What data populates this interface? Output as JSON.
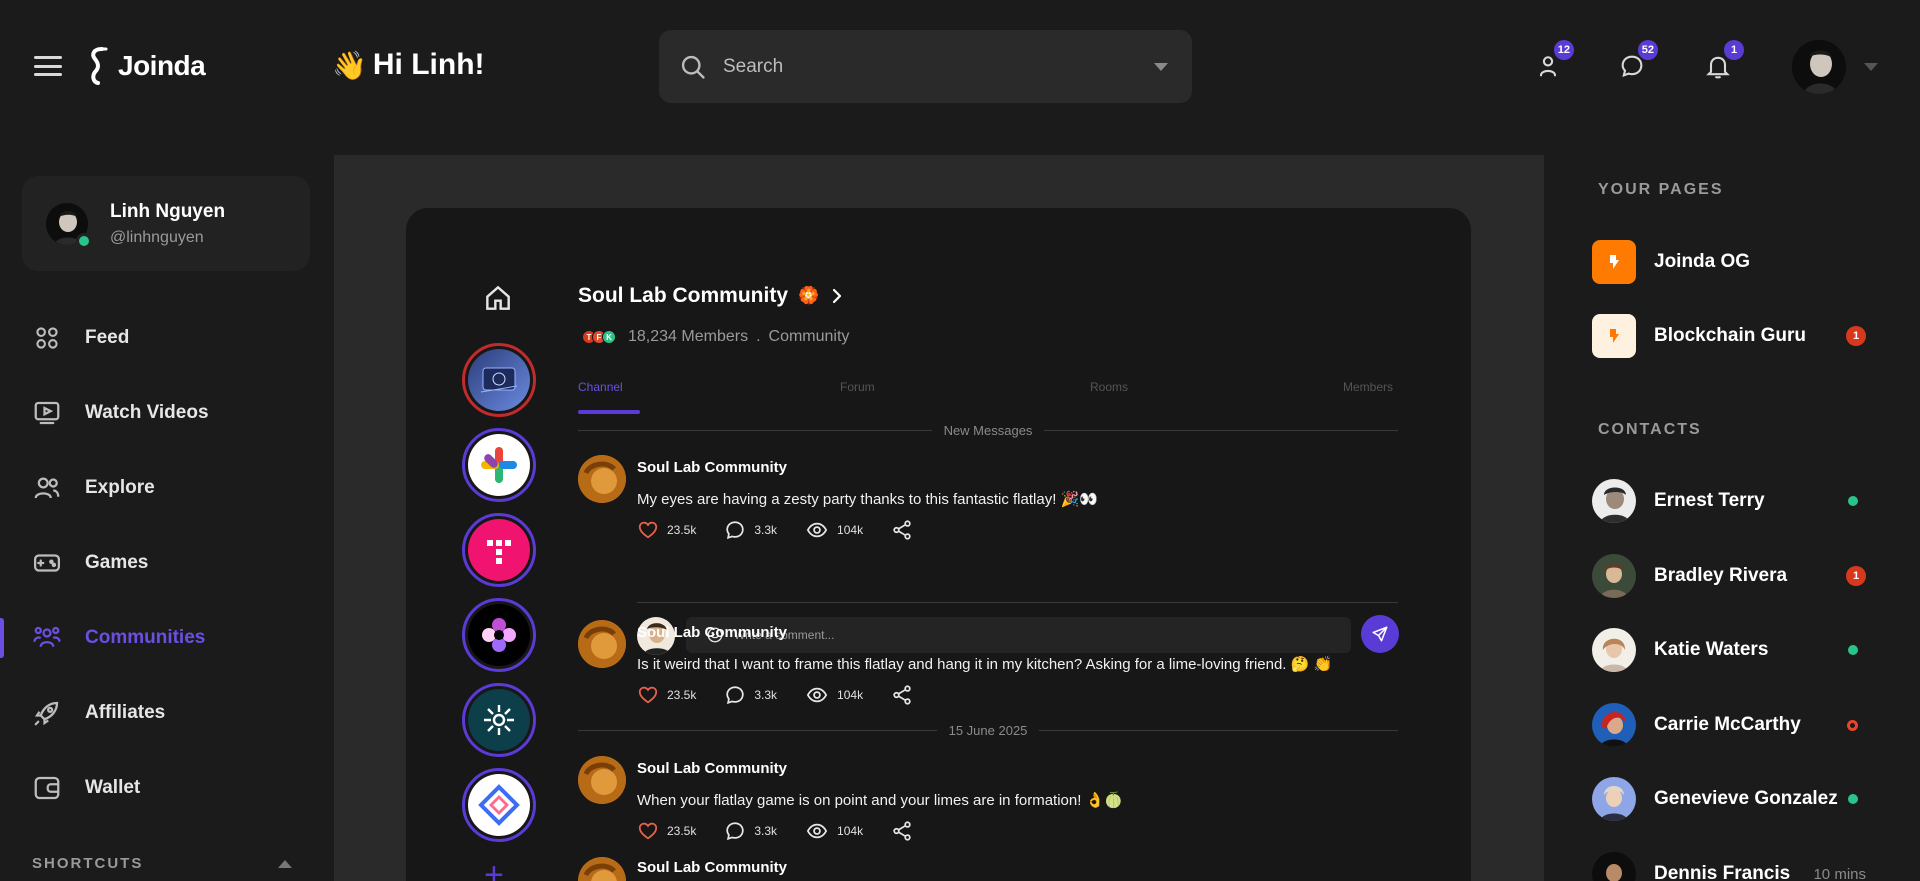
{
  "app": {
    "name": "Joinda",
    "greeting": "Hi Linh!",
    "greeting_emoji": "👋"
  },
  "search": {
    "placeholder": "Search"
  },
  "topbar": {
    "friend_requests_count": "12",
    "messages_count": "52",
    "notifications_count": "1"
  },
  "profile": {
    "name": "Linh Nguyen",
    "handle": "@linhnguyen",
    "status": "online"
  },
  "nav": {
    "items": [
      {
        "label": "Feed",
        "icon": "feed-icon"
      },
      {
        "label": "Watch Videos",
        "icon": "video-icon"
      },
      {
        "label": "Explore",
        "icon": "explore-icon"
      },
      {
        "label": "Games",
        "icon": "gamepad-icon"
      },
      {
        "label": "Communities",
        "icon": "communities-icon",
        "active": true
      },
      {
        "label": "Affiliates",
        "icon": "rocket-icon"
      },
      {
        "label": "Wallet",
        "icon": "wallet-icon"
      }
    ],
    "shortcuts_label": "SHORTCUTS"
  },
  "community": {
    "title": "Soul Lab Community",
    "title_emoji": "🏵️",
    "members": "18,234 Members",
    "type": "Community",
    "mini_avatars": [
      "T",
      "F",
      "K"
    ],
    "tabs": [
      "Channel",
      "Forum",
      "Rooms",
      "Members"
    ],
    "active_tab": "Channel",
    "new_messages_label": "New Messages",
    "date_label": "15 June 2025",
    "comment_placeholder": "Write a comment...",
    "messages": [
      {
        "author": "Soul Lab Community",
        "text": "My eyes are having a zesty party thanks to this fantastic flatlay! 🎉👀",
        "likes": "23.5k",
        "comments": "3.3k",
        "views": "104k"
      },
      {
        "author": "Soul Lab Community",
        "text": "Is it weird that I want to frame this flatlay and hang it in my kitchen? Asking for a lime-loving friend. 🤔 👏",
        "likes": "23.5k",
        "comments": "3.3k",
        "views": "104k"
      },
      {
        "author": "Soul Lab Community",
        "text": "When your flatlay game is on point and your limes are in formation! 👌🍈",
        "likes": "23.5k",
        "comments": "3.3k",
        "views": "104k"
      },
      {
        "author": "Soul Lab Community"
      }
    ]
  },
  "right": {
    "your_pages_heading": "YOUR PAGES",
    "pages": [
      {
        "name": "Joinda OG",
        "logo_bg": "#ff7a00",
        "badge": ""
      },
      {
        "name": "Blockchain Guru",
        "logo_bg": "#fff1e0",
        "badge": "1"
      }
    ],
    "contacts_heading": "CONTACTS",
    "contacts": [
      {
        "name": "Ernest Terry",
        "status": "online",
        "badge": ""
      },
      {
        "name": "Bradley Rivera",
        "status": "badge",
        "badge": "1"
      },
      {
        "name": "Katie Waters",
        "status": "online",
        "badge": ""
      },
      {
        "name": "Carrie McCarthy",
        "status": "busy",
        "badge": ""
      },
      {
        "name": "Genevieve Gonzalez",
        "status": "online",
        "badge": ""
      },
      {
        "name": "Dennis Francis",
        "status": "away",
        "time": "10 mins"
      }
    ]
  },
  "colors": {
    "accent": "#5b3bd6",
    "online": "#2ac48a",
    "alert": "#d8381c",
    "background": "#1b1b1b"
  }
}
